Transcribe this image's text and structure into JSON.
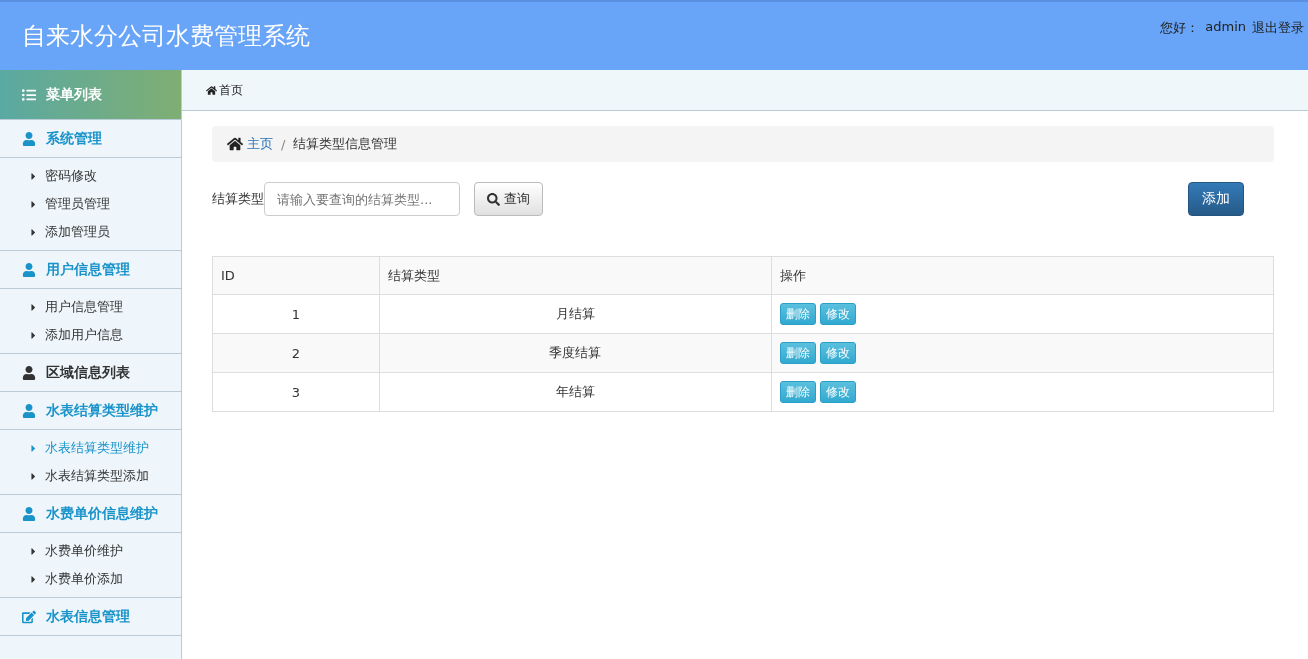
{
  "header": {
    "title": "自来水分公司水费管理系统",
    "greeting": "您好：",
    "user": "admin",
    "logout": "退出登录"
  },
  "sidebar": {
    "title": "菜单列表",
    "groups": [
      {
        "label": "系统管理",
        "kind": "group",
        "items": [
          {
            "label": "密码修改",
            "selected": false
          },
          {
            "label": "管理员管理",
            "selected": false
          },
          {
            "label": "添加管理员",
            "selected": false
          }
        ]
      },
      {
        "label": "用户信息管理",
        "kind": "group",
        "items": [
          {
            "label": "用户信息管理",
            "selected": false
          },
          {
            "label": "添加用户信息",
            "selected": false
          }
        ]
      },
      {
        "label": "区域信息列表",
        "kind": "link"
      },
      {
        "label": "水表结算类型维护",
        "kind": "group",
        "items": [
          {
            "label": "水表结算类型维护",
            "selected": true
          },
          {
            "label": "水表结算类型添加",
            "selected": false
          }
        ]
      },
      {
        "label": "水费单价信息维护",
        "kind": "group",
        "items": [
          {
            "label": "水费单价维护",
            "selected": false
          },
          {
            "label": "水费单价添加",
            "selected": false
          }
        ]
      },
      {
        "label": "水表信息管理",
        "kind": "form"
      }
    ]
  },
  "tab": {
    "label": "首页"
  },
  "breadcrumb": {
    "home": "主页",
    "separator": "/",
    "current": "结算类型信息管理"
  },
  "search": {
    "label": "结算类型",
    "placeholder": "请输入要查询的结算类型...",
    "button": "查询",
    "add": "添加"
  },
  "table": {
    "columns": [
      "ID",
      "结算类型",
      "操作"
    ],
    "rows": [
      {
        "id": "1",
        "type": "月结算",
        "actions": [
          "删除",
          "修改"
        ]
      },
      {
        "id": "2",
        "type": "季度结算",
        "actions": [
          "删除",
          "修改"
        ]
      },
      {
        "id": "3",
        "type": "年结算",
        "actions": [
          "删除",
          "修改"
        ]
      }
    ]
  }
}
